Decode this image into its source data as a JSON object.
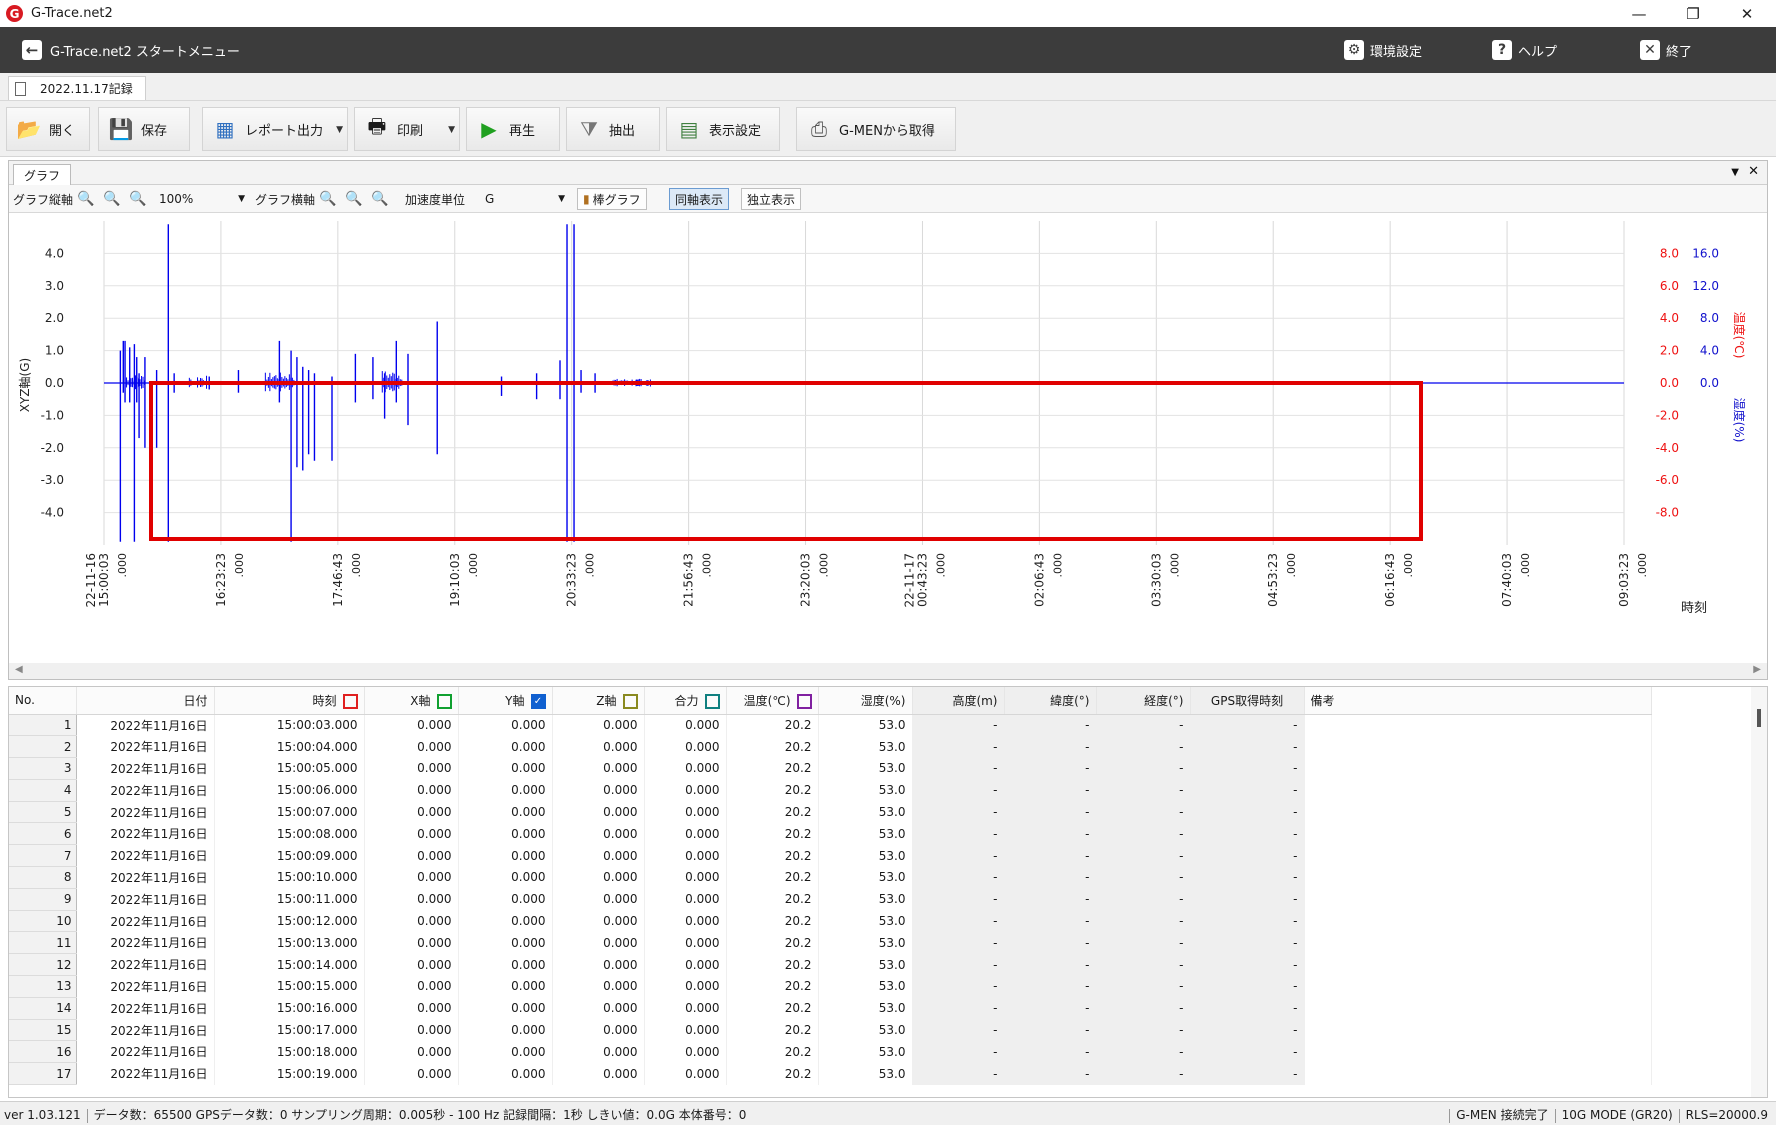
{
  "window": {
    "title": "G-Trace.net2",
    "logo_letter": "G"
  },
  "menubar": {
    "title": "G-Trace.net2 スタートメニュー",
    "settings": "環境設定",
    "help": "ヘルプ",
    "exit": "終了"
  },
  "document_tab": {
    "label": "2022.11.17記録"
  },
  "toolbar": {
    "open": "開く",
    "save": "保存",
    "report": "レポート出力",
    "print": "印刷",
    "play": "再生",
    "extract": "抽出",
    "display_settings": "表示設定",
    "gmen_get": "G-MENから取得"
  },
  "graph_panel": {
    "tab": "グラフ",
    "vertical_axis_label": "グラフ縦軸",
    "zoom": "100%",
    "horizontal_axis_label": "グラフ横軸",
    "accel_unit_label": "加速度単位",
    "accel_unit": "G",
    "bar_graph": "棒グラフ",
    "same_axis": "同軸表示",
    "independent": "独立表示"
  },
  "chart_data": {
    "type": "line",
    "series": [
      {
        "name": "Z軸",
        "color": "#0000ee",
        "spikes": [
          [
            0.14,
            1.0,
            -4.9
          ],
          [
            0.165,
            1.3,
            -0.3
          ],
          [
            0.18,
            1.3,
            -0.6
          ],
          [
            0.22,
            1.1,
            -0.6
          ],
          [
            0.26,
            1.2,
            -4.9
          ],
          [
            0.28,
            0.8,
            -0.6
          ],
          [
            0.3,
            0.3,
            -1.7
          ],
          [
            0.35,
            0.8,
            -2.0
          ],
          [
            0.45,
            0.4,
            -2.0
          ],
          [
            0.55,
            4.9,
            -4.9
          ],
          [
            0.6,
            0.3,
            -0.3
          ],
          [
            0.9,
            0.2,
            -0.2
          ],
          [
            1.15,
            0.4,
            -0.3
          ],
          [
            1.5,
            1.3,
            -0.6
          ],
          [
            1.6,
            1.0,
            -4.9
          ],
          [
            1.65,
            0.8,
            -2.6
          ],
          [
            1.7,
            0.5,
            -2.7
          ],
          [
            1.75,
            0.4,
            -2.2
          ],
          [
            1.8,
            0.3,
            -2.4
          ],
          [
            1.95,
            0.2,
            -2.4
          ],
          [
            2.15,
            0.9,
            -0.6
          ],
          [
            2.3,
            0.8,
            -0.5
          ],
          [
            2.4,
            0.3,
            -1.1
          ],
          [
            2.5,
            1.3,
            -0.6
          ],
          [
            2.6,
            0.9,
            -1.3
          ],
          [
            2.85,
            1.9,
            -2.2
          ],
          [
            3.4,
            0.2,
            -0.4
          ],
          [
            3.7,
            0.3,
            -0.5
          ],
          [
            3.9,
            0.7,
            -0.5
          ],
          [
            3.96,
            4.9,
            -4.9
          ],
          [
            4.02,
            4.9,
            -4.9
          ],
          [
            4.08,
            0.4,
            -0.3
          ],
          [
            4.2,
            0.3,
            -0.3
          ]
        ],
        "noise_bands": [
          [
            0.18,
            0.35,
            0.2
          ],
          [
            0.73,
            0.75,
            0.2
          ],
          [
            0.8,
            0.88,
            0.18
          ],
          [
            1.38,
            1.63,
            0.25
          ],
          [
            2.38,
            2.55,
            0.3
          ],
          [
            4.35,
            4.6,
            0.1
          ]
        ],
        "dense_tail": [
          4.55,
          4.7,
          0.08
        ]
      }
    ],
    "y_left": {
      "label": "XYZ軸(G)",
      "ticks": [
        "4.0",
        "3.0",
        "2.0",
        "1.0",
        "0.0",
        "-1.0",
        "-2.0",
        "-3.0",
        "-4.0"
      ],
      "values": [
        4,
        3,
        2,
        1,
        0,
        -1,
        -2,
        -3,
        -4
      ],
      "range": [
        -5,
        5
      ]
    },
    "y_right_temp": {
      "label": "温度(℃)",
      "color": "#ee1111",
      "ticks": [
        "8.0",
        "6.0",
        "4.0",
        "2.0",
        "0.0",
        "-2.0",
        "-4.0",
        "-6.0",
        "-8.0"
      ]
    },
    "y_right_humid": {
      "label": "湿度(%)",
      "color": "#1111cc",
      "ticks": [
        "16.0",
        "12.0",
        "8.0",
        "4.0",
        "0.0"
      ]
    },
    "x_ticks": [
      {
        "date": "22-11-16",
        "time": "15:00:03",
        "ms": ".000"
      },
      {
        "date": "",
        "time": "16:23:23",
        "ms": ".000"
      },
      {
        "date": "",
        "time": "17:46:43",
        "ms": ".000"
      },
      {
        "date": "",
        "time": "19:10:03",
        "ms": ".000"
      },
      {
        "date": "",
        "time": "20:33:23",
        "ms": ".000"
      },
      {
        "date": "",
        "time": "21:56:43",
        "ms": ".000"
      },
      {
        "date": "",
        "time": "23:20:03",
        "ms": ".000"
      },
      {
        "date": "22-11-17",
        "time": "00:43:23",
        "ms": ".000"
      },
      {
        "date": "",
        "time": "02:06:43",
        "ms": ".000"
      },
      {
        "date": "",
        "time": "03:30:03",
        "ms": ".000"
      },
      {
        "date": "",
        "time": "04:53:23",
        "ms": ".000"
      },
      {
        "date": "",
        "time": "06:16:43",
        "ms": ".000"
      },
      {
        "date": "",
        "time": "07:40:03",
        "ms": ".000"
      },
      {
        "date": "",
        "time": "09:03:23",
        "ms": ".000"
      }
    ],
    "x_label": "時刻",
    "highlight_box": {
      "color": "#e00000"
    }
  },
  "table": {
    "headers": {
      "no": "No.",
      "date": "日付",
      "time": "時刻",
      "x": "X軸",
      "y": "Y軸",
      "z": "Z軸",
      "sum": "合力",
      "temp": "温度(℃)",
      "humid": "湿度(%)",
      "alt": "高度(m)",
      "lat": "緯度(°)",
      "lon": "経度(°)",
      "gps": "GPS取得時刻",
      "note": "備考"
    },
    "checkbox_colors": {
      "x": "#e02020",
      "y": "#10a030",
      "z": "#1060d0",
      "sum": "#8a8a20",
      "temp": "#108080",
      "humid": "#8020a0"
    },
    "rows": [
      {
        "no": "1",
        "date": "2022年11月16日",
        "time": "15:00:03.000",
        "x": "0.000",
        "y": "0.000",
        "z": "0.000",
        "sum": "0.000",
        "temp": "20.2",
        "humid": "53.0",
        "alt": "-",
        "lat": "-",
        "lon": "-",
        "gps": "-"
      },
      {
        "no": "2",
        "date": "2022年11月16日",
        "time": "15:00:04.000",
        "x": "0.000",
        "y": "0.000",
        "z": "0.000",
        "sum": "0.000",
        "temp": "20.2",
        "humid": "53.0",
        "alt": "-",
        "lat": "-",
        "lon": "-",
        "gps": "-"
      },
      {
        "no": "3",
        "date": "2022年11月16日",
        "time": "15:00:05.000",
        "x": "0.000",
        "y": "0.000",
        "z": "0.000",
        "sum": "0.000",
        "temp": "20.2",
        "humid": "53.0",
        "alt": "-",
        "lat": "-",
        "lon": "-",
        "gps": "-"
      },
      {
        "no": "4",
        "date": "2022年11月16日",
        "time": "15:00:06.000",
        "x": "0.000",
        "y": "0.000",
        "z": "0.000",
        "sum": "0.000",
        "temp": "20.2",
        "humid": "53.0",
        "alt": "-",
        "lat": "-",
        "lon": "-",
        "gps": "-"
      },
      {
        "no": "5",
        "date": "2022年11月16日",
        "time": "15:00:07.000",
        "x": "0.000",
        "y": "0.000",
        "z": "0.000",
        "sum": "0.000",
        "temp": "20.2",
        "humid": "53.0",
        "alt": "-",
        "lat": "-",
        "lon": "-",
        "gps": "-"
      },
      {
        "no": "6",
        "date": "2022年11月16日",
        "time": "15:00:08.000",
        "x": "0.000",
        "y": "0.000",
        "z": "0.000",
        "sum": "0.000",
        "temp": "20.2",
        "humid": "53.0",
        "alt": "-",
        "lat": "-",
        "lon": "-",
        "gps": "-"
      },
      {
        "no": "7",
        "date": "2022年11月16日",
        "time": "15:00:09.000",
        "x": "0.000",
        "y": "0.000",
        "z": "0.000",
        "sum": "0.000",
        "temp": "20.2",
        "humid": "53.0",
        "alt": "-",
        "lat": "-",
        "lon": "-",
        "gps": "-"
      },
      {
        "no": "8",
        "date": "2022年11月16日",
        "time": "15:00:10.000",
        "x": "0.000",
        "y": "0.000",
        "z": "0.000",
        "sum": "0.000",
        "temp": "20.2",
        "humid": "53.0",
        "alt": "-",
        "lat": "-",
        "lon": "-",
        "gps": "-"
      },
      {
        "no": "9",
        "date": "2022年11月16日",
        "time": "15:00:11.000",
        "x": "0.000",
        "y": "0.000",
        "z": "0.000",
        "sum": "0.000",
        "temp": "20.2",
        "humid": "53.0",
        "alt": "-",
        "lat": "-",
        "lon": "-",
        "gps": "-"
      },
      {
        "no": "10",
        "date": "2022年11月16日",
        "time": "15:00:12.000",
        "x": "0.000",
        "y": "0.000",
        "z": "0.000",
        "sum": "0.000",
        "temp": "20.2",
        "humid": "53.0",
        "alt": "-",
        "lat": "-",
        "lon": "-",
        "gps": "-"
      },
      {
        "no": "11",
        "date": "2022年11月16日",
        "time": "15:00:13.000",
        "x": "0.000",
        "y": "0.000",
        "z": "0.000",
        "sum": "0.000",
        "temp": "20.2",
        "humid": "53.0",
        "alt": "-",
        "lat": "-",
        "lon": "-",
        "gps": "-"
      },
      {
        "no": "12",
        "date": "2022年11月16日",
        "time": "15:00:14.000",
        "x": "0.000",
        "y": "0.000",
        "z": "0.000",
        "sum": "0.000",
        "temp": "20.2",
        "humid": "53.0",
        "alt": "-",
        "lat": "-",
        "lon": "-",
        "gps": "-"
      },
      {
        "no": "13",
        "date": "2022年11月16日",
        "time": "15:00:15.000",
        "x": "0.000",
        "y": "0.000",
        "z": "0.000",
        "sum": "0.000",
        "temp": "20.2",
        "humid": "53.0",
        "alt": "-",
        "lat": "-",
        "lon": "-",
        "gps": "-"
      },
      {
        "no": "14",
        "date": "2022年11月16日",
        "time": "15:00:16.000",
        "x": "0.000",
        "y": "0.000",
        "z": "0.000",
        "sum": "0.000",
        "temp": "20.2",
        "humid": "53.0",
        "alt": "-",
        "lat": "-",
        "lon": "-",
        "gps": "-"
      },
      {
        "no": "15",
        "date": "2022年11月16日",
        "time": "15:00:17.000",
        "x": "0.000",
        "y": "0.000",
        "z": "0.000",
        "sum": "0.000",
        "temp": "20.2",
        "humid": "53.0",
        "alt": "-",
        "lat": "-",
        "lon": "-",
        "gps": "-"
      },
      {
        "no": "16",
        "date": "2022年11月16日",
        "time": "15:00:18.000",
        "x": "0.000",
        "y": "0.000",
        "z": "0.000",
        "sum": "0.000",
        "temp": "20.2",
        "humid": "53.0",
        "alt": "-",
        "lat": "-",
        "lon": "-",
        "gps": "-"
      },
      {
        "no": "17",
        "date": "2022年11月16日",
        "time": "15:00:19.000",
        "x": "0.000",
        "y": "0.000",
        "z": "0.000",
        "sum": "0.000",
        "temp": "20.2",
        "humid": "53.0",
        "alt": "-",
        "lat": "-",
        "lon": "-",
        "gps": "-"
      }
    ]
  },
  "statusbar": {
    "version": "ver 1.03.121",
    "info": "データ数：65500  GPSデータ数：0  サンプリング周期：0.005秒 - 100 Hz  記録間隔：1秒  しきい値：0.0G  本体番号：0",
    "connection": "G-MEN 接続完了",
    "mode": "10G MODE (GR20)",
    "rls": "RLS=20000.9"
  }
}
